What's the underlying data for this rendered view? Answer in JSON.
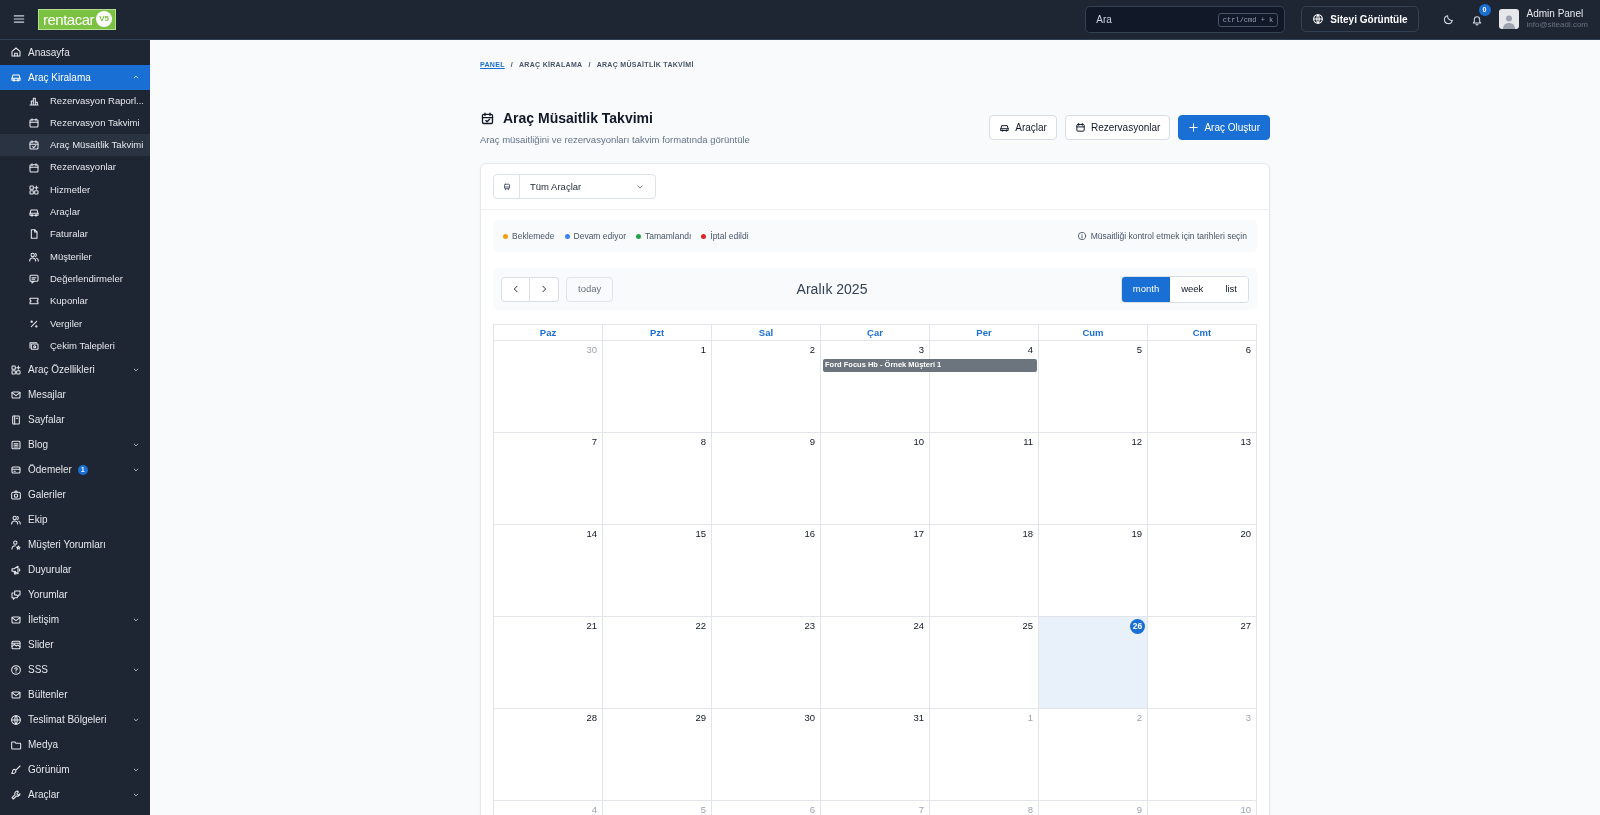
{
  "header": {
    "logo": {
      "word": "rentacar",
      "mark": "V5"
    },
    "search": {
      "placeholder": "Ara",
      "shortcut": "ctrl/cmd + k"
    },
    "site_button": "Siteyi Görüntüle",
    "notifications": "0",
    "user": {
      "name": "Admin Panel",
      "email": "info@siteadi.com"
    }
  },
  "sidebar": {
    "items": [
      {
        "label": "Anasayfa",
        "selected": false
      },
      {
        "label": "Araç Kiralama",
        "selected": true,
        "expanded": true,
        "children": [
          {
            "label": "Rezervasyon Raporl...",
            "selected": false
          },
          {
            "label": "Rezervasyon Takvimi",
            "selected": false
          },
          {
            "label": "Araç Müsaitlik Takvimi",
            "selected": true
          },
          {
            "label": "Rezervasyonlar",
            "selected": false
          },
          {
            "label": "Hizmetler",
            "selected": false
          },
          {
            "label": "Araçlar",
            "selected": false
          },
          {
            "label": "Faturalar",
            "selected": false
          },
          {
            "label": "Müşteriler",
            "selected": false
          },
          {
            "label": "Değerlendirmeler",
            "selected": false
          },
          {
            "label": "Kuponlar",
            "selected": false
          },
          {
            "label": "Vergiler",
            "selected": false
          },
          {
            "label": "Çekim Talepleri",
            "selected": false
          }
        ]
      },
      {
        "label": "Araç Özellikleri",
        "selected": false,
        "expanded": false
      },
      {
        "label": "Mesajlar",
        "selected": false
      },
      {
        "label": "Sayfalar",
        "selected": false
      },
      {
        "label": "Blog",
        "selected": false,
        "expanded": false
      },
      {
        "label": "Ödemeler",
        "selected": false,
        "expanded": false,
        "badge": "1"
      },
      {
        "label": "Galeriler",
        "selected": false
      },
      {
        "label": "Ekip",
        "selected": false
      },
      {
        "label": "Müşteri Yorumları",
        "selected": false
      },
      {
        "label": "Duyurular",
        "selected": false
      },
      {
        "label": "Yorumlar",
        "selected": false
      },
      {
        "label": "İletişim",
        "selected": false,
        "expanded": false
      },
      {
        "label": "Slider",
        "selected": false
      },
      {
        "label": "SSS",
        "selected": false,
        "expanded": false
      },
      {
        "label": "Bültenler",
        "selected": false
      },
      {
        "label": "Teslimat Bölgeleri",
        "selected": false,
        "expanded": false
      },
      {
        "label": "Medya",
        "selected": false
      },
      {
        "label": "Görünüm",
        "selected": false,
        "expanded": false
      },
      {
        "label": "Araçlar",
        "selected": false,
        "expanded": false
      }
    ]
  },
  "breadcrumb": {
    "separator": "/",
    "items": [
      {
        "label": "PANEL",
        "link": true
      },
      {
        "label": "ARAÇ KİRALAMA",
        "link": false
      },
      {
        "label": "ARAÇ MÜSAİTLİK TAKVİMİ",
        "link": false
      }
    ]
  },
  "page": {
    "title": "Araç Müsaitlik Takvimi",
    "subtitle": "Araç müsaitliğini ve rezervasyonları takvim formatında görüntüle",
    "actions": [
      {
        "label": "Araçlar",
        "kind": "outline"
      },
      {
        "label": "Rezervasyonlar",
        "kind": "outline"
      },
      {
        "label": "Araç Oluştur",
        "kind": "primary"
      }
    ]
  },
  "filter": {
    "value": "Tüm Araçlar"
  },
  "legend": [
    {
      "label": "Beklemede",
      "color": "#f59e0b"
    },
    {
      "label": "Devam ediyor",
      "color": "#3b82f6"
    },
    {
      "label": "Tamamlandı",
      "color": "#22a34a"
    },
    {
      "label": "İptal edildi",
      "color": "#dc2626"
    }
  ],
  "hint": "Müsaitliği kontrol etmek için tarihleri seçin",
  "calendar": {
    "title": "Aralık 2025",
    "today_button": "today",
    "views": [
      {
        "label": "month",
        "selected": true
      },
      {
        "label": "week",
        "selected": false
      },
      {
        "label": "list",
        "selected": false
      }
    ],
    "weekdays": [
      "Paz",
      "Pzt",
      "Sal",
      "Çar",
      "Per",
      "Cum",
      "Cmt"
    ],
    "weeks": [
      [
        {
          "day": "30",
          "other_month": true
        },
        {
          "day": "1"
        },
        {
          "day": "2"
        },
        {
          "day": "3",
          "event": {
            "title": "Ford Focus Hb - Örnek Müşteri 1"
          }
        },
        {
          "day": "4",
          "event_continued": true
        },
        {
          "day": "5"
        },
        {
          "day": "6"
        }
      ],
      [
        {
          "day": "7"
        },
        {
          "day": "8"
        },
        {
          "day": "9"
        },
        {
          "day": "10"
        },
        {
          "day": "11"
        },
        {
          "day": "12"
        },
        {
          "day": "13"
        }
      ],
      [
        {
          "day": "14"
        },
        {
          "day": "15"
        },
        {
          "day": "16"
        },
        {
          "day": "17"
        },
        {
          "day": "18"
        },
        {
          "day": "19"
        },
        {
          "day": "20"
        }
      ],
      [
        {
          "day": "21"
        },
        {
          "day": "22"
        },
        {
          "day": "23"
        },
        {
          "day": "24"
        },
        {
          "day": "25"
        },
        {
          "day": "26",
          "today": true
        },
        {
          "day": "27"
        }
      ],
      [
        {
          "day": "28"
        },
        {
          "day": "29"
        },
        {
          "day": "30"
        },
        {
          "day": "31"
        },
        {
          "day": "1",
          "other_month": true
        },
        {
          "day": "2",
          "other_month": true
        },
        {
          "day": "3",
          "other_month": true
        }
      ],
      [
        {
          "day": "4",
          "other_month": true
        },
        {
          "day": "5",
          "other_month": true
        },
        {
          "day": "6",
          "other_month": true
        },
        {
          "day": "7",
          "other_month": true
        },
        {
          "day": "8",
          "other_month": true
        },
        {
          "day": "9",
          "other_month": true
        },
        {
          "day": "10",
          "other_month": true
        }
      ]
    ]
  }
}
